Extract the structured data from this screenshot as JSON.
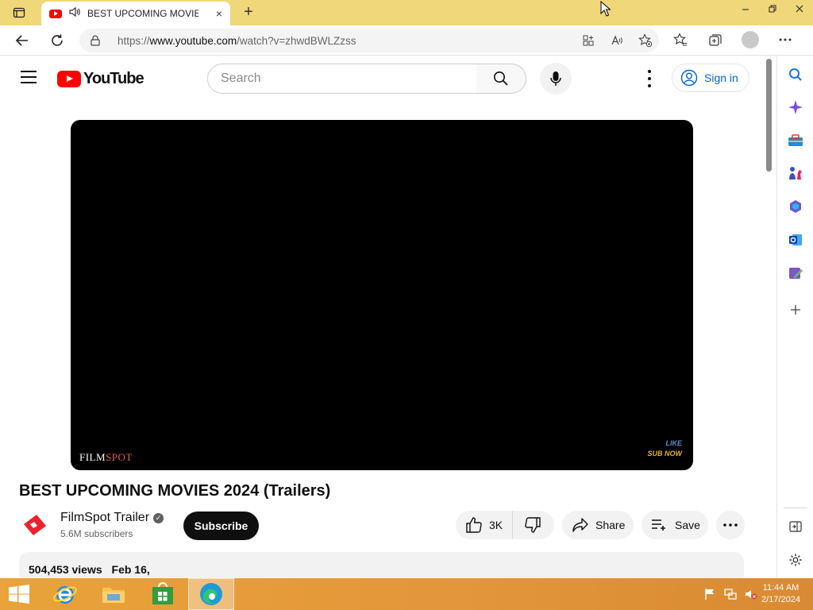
{
  "browser": {
    "tab_title": "BEST UPCOMING MOVIES",
    "url_prefix": "https://",
    "url_host": "www.youtube.com",
    "url_path": "/watch?v=zhwdBWLZzss",
    "new_tab_symbol": "+",
    "close_tab_symbol": "×"
  },
  "youtube": {
    "logo_text": "YouTube",
    "search_placeholder": "Search",
    "sign_in": "Sign in",
    "video": {
      "watermark_brand_a": "FILM",
      "watermark_brand_b": "SPOT",
      "watermark_like": "LIKE",
      "watermark_sub": "SUB NOW"
    },
    "title": "BEST UPCOMING MOVIES 2024 (Trailers)",
    "channel": {
      "name": "FilmSpot Trailer",
      "subscribers": "5.6M subscribers",
      "verified_mark": "✓"
    },
    "subscribe_label": "Subscribe",
    "likes": "3K",
    "share_label": "Share",
    "save_label": "Save",
    "description": {
      "views": "504,453 views",
      "date": "Feb 16,"
    }
  },
  "taskbar": {
    "time": "11:44 AM",
    "date": "2/17/2024"
  },
  "colors": {
    "titlebar": "#f0d77a",
    "youtube_red": "#ff0000",
    "sign_in_blue": "#065fd4",
    "taskbar": "#e3953a"
  }
}
